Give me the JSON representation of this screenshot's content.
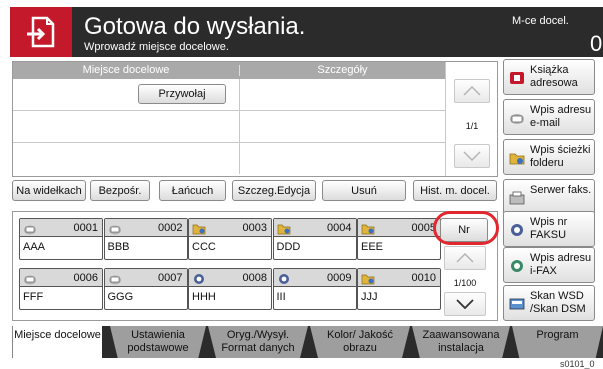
{
  "header": {
    "title": "Gotowa do wysłania.",
    "subtitle": "Wprowadź miejsce docelowe.",
    "dest_label": "M-ce docel.",
    "dest_count": "0"
  },
  "dest_table": {
    "col_destination": "Miejsce docelowe",
    "col_details": "Szczegóły",
    "recall_label": "Przywołaj",
    "page": "1/1"
  },
  "toolbar": {
    "on_hook": "Na widełkach",
    "direct": "Bezpośr.",
    "chain": "Łańcuch",
    "detail_edit": "Szczeg.Edycja",
    "delete": "Usuń",
    "dest_history": "Hist. m. docel."
  },
  "book": {
    "no_label": "Nr",
    "page": "1/100",
    "entries": [
      {
        "num": "0001",
        "name": "AAA",
        "icon": "email-icon"
      },
      {
        "num": "0002",
        "name": "BBB",
        "icon": "email-icon"
      },
      {
        "num": "0003",
        "name": "CCC",
        "icon": "folder-icon"
      },
      {
        "num": "0004",
        "name": "DDD",
        "icon": "folder-icon"
      },
      {
        "num": "0005",
        "name": "EEE",
        "icon": "folder-icon"
      },
      {
        "num": "0006",
        "name": "FFF",
        "icon": "email-icon"
      },
      {
        "num": "0007",
        "name": "GGG",
        "icon": "email-icon"
      },
      {
        "num": "0008",
        "name": "HHH",
        "icon": "ifax-icon"
      },
      {
        "num": "0009",
        "name": "III",
        "icon": "ifax-icon"
      },
      {
        "num": "0010",
        "name": "JJJ",
        "icon": "folder-icon"
      }
    ]
  },
  "right": {
    "address_book": "Książka adresowa",
    "email_entry": "Wpis adresu e-mail",
    "folder_entry": "Wpis ścieżki folderu",
    "fax_server": "Serwer faks.",
    "fax_number": "Wpis nr FAKSU",
    "ifax_entry": "Wpis adresu i-FAX",
    "wsd_scan": "Skan WSD /Skan DSM"
  },
  "tabs": {
    "destination": "Miejsce docelowe",
    "basic_settings": "Ustawienia podstawowe",
    "orig_send": "Oryg./Wysył. Format danych",
    "color_quality": "Kolor/ Jakość obrazu",
    "advanced": "Zaawansowana instalacja",
    "program": "Program"
  },
  "footer_code": "s0101_0",
  "colors": {
    "accent": "#c4192b",
    "highlight": "#e0282e",
    "dark": "#2b2b2b"
  }
}
